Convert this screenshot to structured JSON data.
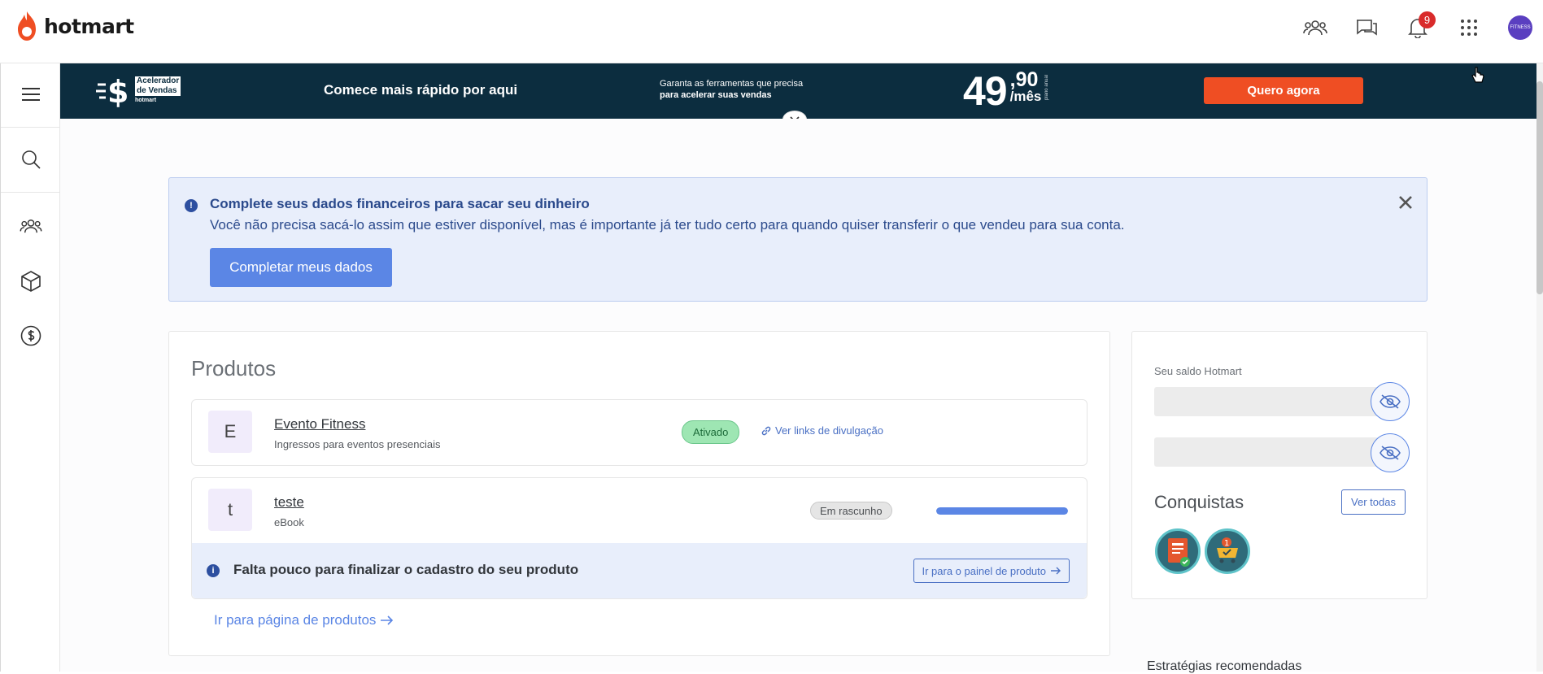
{
  "brand": {
    "name": "hotmart",
    "color": "#ef4e23"
  },
  "header": {
    "icons": [
      "people-icon",
      "chat-icon",
      "bell-icon",
      "apps-grid-icon",
      "avatar"
    ],
    "notifications_count": "9",
    "avatar_text": "FITNESS"
  },
  "sidebar": {
    "items": [
      "menu-icon",
      "search-icon",
      "people-icon",
      "box-icon",
      "dollar-icon"
    ]
  },
  "banner": {
    "logo_line1": "Acelerador",
    "logo_line2": "de Vendas",
    "logo_small": "hotmart",
    "headline": "Comece mais rápido por aqui",
    "sub_line1": "Garanta as ferramentas que precisa",
    "sub_line2": "para acelerar suas vendas",
    "price_int": "49",
    "price_cents": ",90",
    "price_period": "/mês",
    "price_note": "plano anual",
    "cta": "Quero agora"
  },
  "alert": {
    "title": "Complete seus dados financeiros para sacar seu dinheiro",
    "text": "Você não precisa sacá-lo assim que estiver disponível, mas é importante já ter tudo certo para quando quiser transferir o que vendeu para sua conta.",
    "button": "Completar meus dados"
  },
  "products": {
    "title": "Produtos",
    "items": [
      {
        "letter": "E",
        "name": "Evento Fitness",
        "type": "Ingressos para eventos presenciais",
        "status": "Ativado",
        "link": "Ver links de divulgação"
      },
      {
        "letter": "t",
        "name": "teste",
        "type": "eBook",
        "status": "Em rascunho",
        "progress": 1.0,
        "footer_text": "Falta pouco para finalizar o cadastro do seu produto",
        "footer_button": "Ir para o painel de produto"
      }
    ],
    "go_link": "Ir para página de produtos"
  },
  "balance": {
    "label": "Seu saldo Hotmart",
    "achievements_title": "Conquistas",
    "see_all": "Ver todas"
  },
  "strategies_title": "Estratégias recomendadas"
}
